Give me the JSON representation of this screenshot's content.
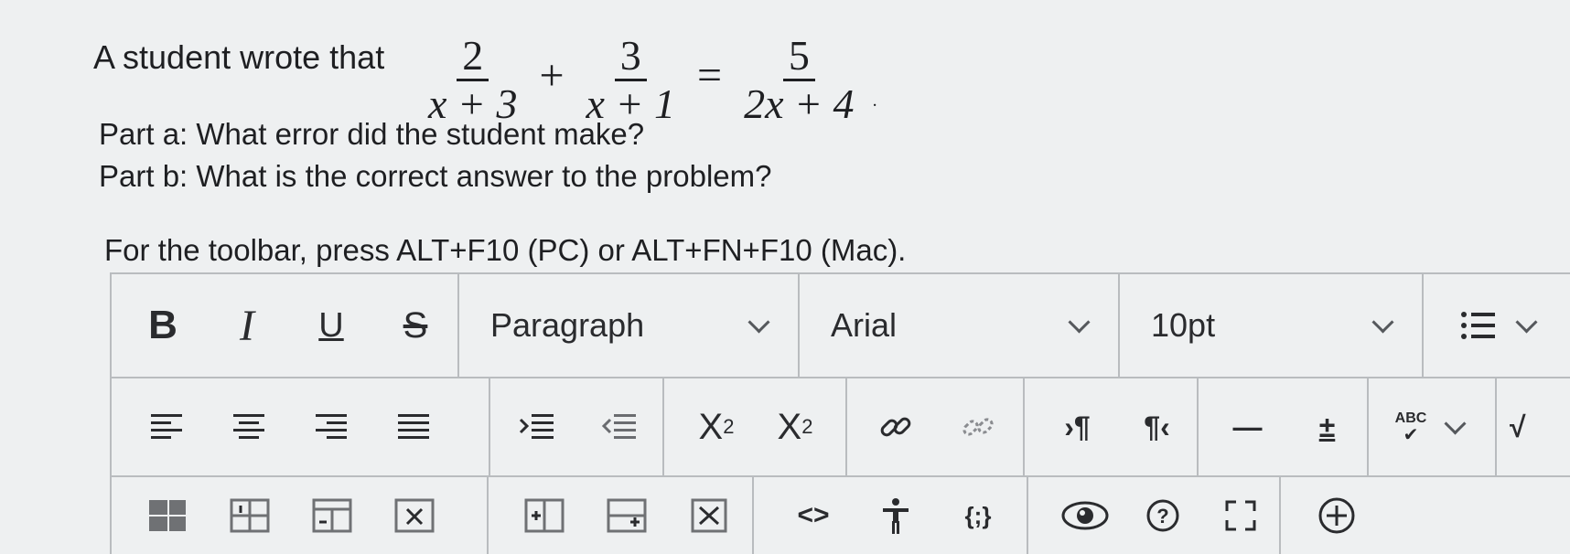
{
  "question": {
    "lead": "A student wrote that",
    "equation": {
      "frac1": {
        "num": "2",
        "den": "x + 3"
      },
      "op1": "+",
      "frac2": {
        "num": "3",
        "den": "x + 1"
      },
      "op2": "=",
      "frac3": {
        "num": "5",
        "den": "2x + 4"
      },
      "end": "."
    },
    "part_a": "Part a: What error did the student make?",
    "part_b": "Part b: What is the correct answer to the problem?"
  },
  "toolbar_hint": "For the toolbar, press ALT+F10 (PC) or ALT+FN+F10 (Mac).",
  "toolbar": {
    "bold": "B",
    "italic": "I",
    "underline": "U",
    "strike": "S",
    "paragraph_select": "Paragraph",
    "font_select": "Arial",
    "size_select": "10pt",
    "superscript": {
      "base": "X",
      "script": "2"
    },
    "subscript": {
      "base": "X",
      "script": "2"
    },
    "ltr": "›¶",
    "rtl": "¶‹",
    "hr": "—",
    "plusminus": "±",
    "spell": "ABC",
    "code": "<>",
    "curly": "{;}"
  },
  "colors": {
    "background": "#eef0f1",
    "border": "#b9bcbf",
    "text": "#1e1f22"
  }
}
